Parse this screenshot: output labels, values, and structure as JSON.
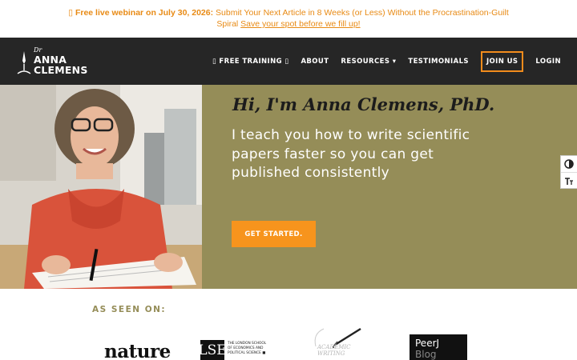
{
  "announcement": {
    "icon": "lightbulb-icon",
    "bold": "Free live webinar on July 30, 2026:",
    "text": " Submit Your Next Article in 8 Weeks (or Less) Without the Procrastination-Guilt Spiral ",
    "link": "Save your spot before we fill up!",
    "color": "#e88a14"
  },
  "logo": {
    "prefix": "Dr",
    "line1": "ANNA",
    "line2": "CLEMENS"
  },
  "nav": {
    "items": [
      {
        "label": "▯ FREE TRAINING ▯"
      },
      {
        "label": "ABOUT"
      },
      {
        "label": "RESOURCES ▾"
      },
      {
        "label": "TESTIMONIALS"
      },
      {
        "label": "JOIN US"
      },
      {
        "label": "LOGIN"
      }
    ]
  },
  "hero": {
    "greeting": "Hi, I'm Anna Clemens, PhD.",
    "tagline": "I teach you how to write scientific papers faster so you can get published consistently",
    "cta": "GET STARTED.",
    "bg_color": "#958d58",
    "cta_color": "#f7941d"
  },
  "accessibility": {
    "contrast_icon": "contrast-icon",
    "font_icon": "font-size-icon"
  },
  "seen_on": {
    "heading": "AS SEEN ON:",
    "nature": "nature",
    "lse_mark": "LSE",
    "lse_line1": "THE LONDON SCHOOL",
    "lse_line2": "OF ECONOMICS AND",
    "lse_line3": "POLITICAL SCIENCE ■",
    "aw_line1": "ACADEMIC",
    "aw_line2": "WRITING",
    "peerj_line1": "PeerJ",
    "peerj_line2": "Blog"
  }
}
